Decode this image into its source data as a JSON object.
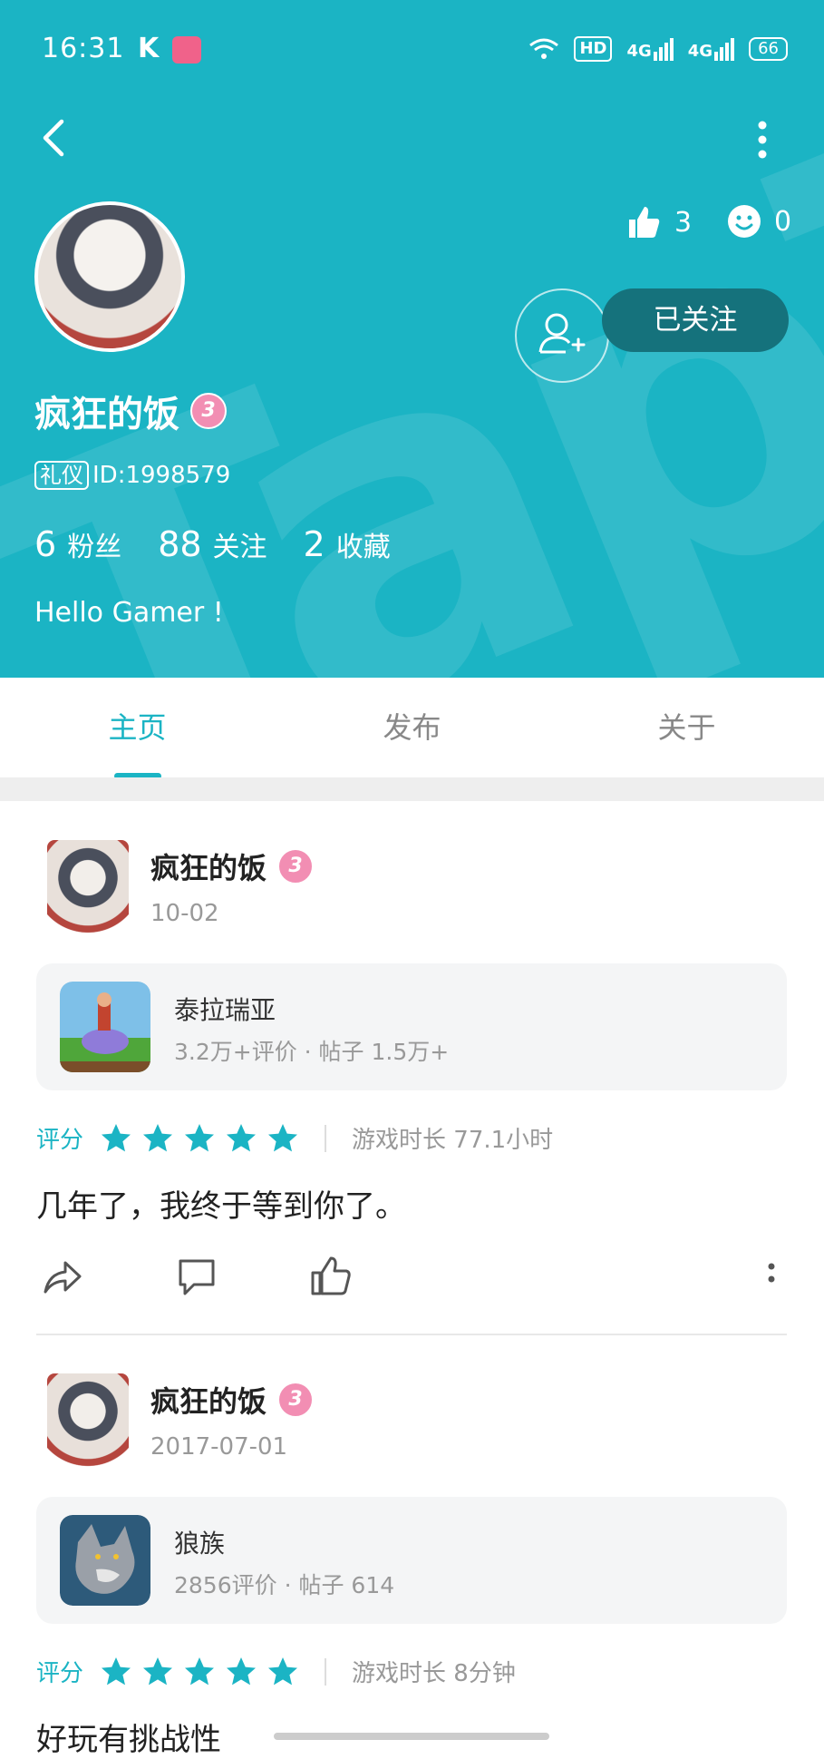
{
  "status_bar": {
    "time": "16:31",
    "k_icon": "K",
    "hd": "HD",
    "net1": "4G",
    "net2": "4G",
    "battery": "66"
  },
  "profile": {
    "watermark": "TapTap",
    "username": "疯狂的饭",
    "level": "3",
    "tag": "礼仪",
    "id_text": "ID:1998579",
    "likes": "3",
    "faces": "0",
    "follow_label": "已关注",
    "stats": [
      {
        "num": "6",
        "label": "粉丝"
      },
      {
        "num": "88",
        "label": "关注"
      },
      {
        "num": "2",
        "label": "收藏"
      }
    ],
    "bio": "Hello Gamer !"
  },
  "tabs": [
    {
      "label": "主页",
      "active": true
    },
    {
      "label": "发布",
      "active": false
    },
    {
      "label": "关于",
      "active": false
    }
  ],
  "posts": [
    {
      "author": "疯狂的饭",
      "level": "3",
      "date": "10-02",
      "game_name": "泰拉瑞亚",
      "game_meta": "3.2万+评价 · 帖子 1.5万+",
      "rating_label": "评分",
      "stars": 5,
      "playtime": "游戏时长 77.1小时",
      "text": "几年了，我终于等到你了。"
    },
    {
      "author": "疯狂的饭",
      "level": "3",
      "date": "2017-07-01",
      "game_name": "狼族",
      "game_meta": "2856评价 · 帖子 614",
      "rating_label": "评分",
      "stars": 5,
      "playtime": "游戏时长 8分钟",
      "text": "好玩有挑战性"
    }
  ],
  "colors": {
    "accent": "#1bb4c4",
    "follow_btn": "#15727c",
    "level_badge": "#f28eb3"
  }
}
